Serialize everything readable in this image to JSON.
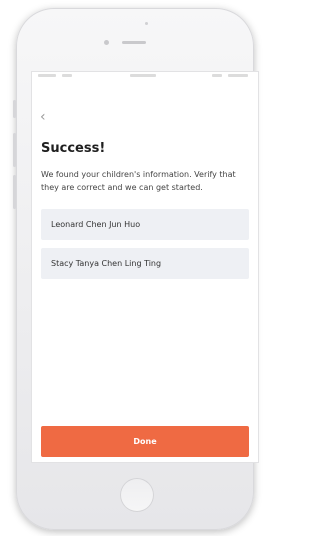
{
  "screen": {
    "back_glyph": "‹",
    "title": "Success!",
    "description": "We found your children's information. Verify that they are correct and we can get started.",
    "children": [
      {
        "name": "Leonard Chen Jun Huo"
      },
      {
        "name": "Stacy Tanya Chen Ling Ting"
      }
    ],
    "done_label": "Done"
  },
  "colors": {
    "accent": "#ef6a43",
    "card_background": "#eef0f4",
    "title_text": "#1f1f1f",
    "body_text": "#444444"
  },
  "icons": {
    "back": "chevron-left-icon"
  }
}
